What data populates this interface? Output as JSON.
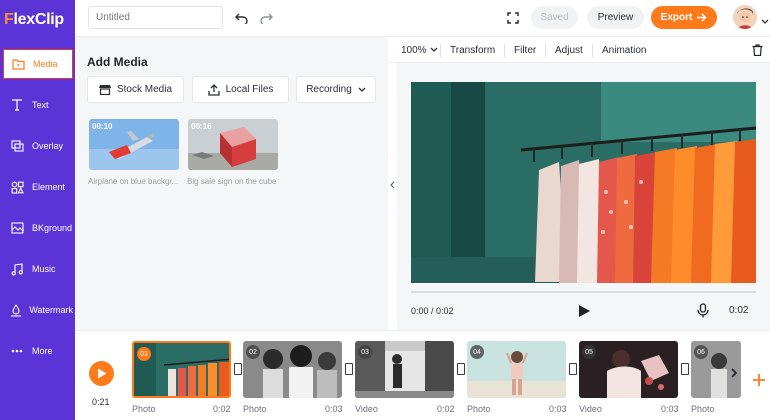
{
  "app": {
    "logo_text": "lexClip",
    "logo_mark": "F",
    "brand_color": "#5b34d8",
    "accent_color": "#ff7a1a"
  },
  "sidebar": {
    "items": [
      {
        "label": "Media",
        "icon": "folder-media-icon",
        "active": true
      },
      {
        "label": "Text",
        "icon": "text-icon"
      },
      {
        "label": "Overlay",
        "icon": "overlay-icon"
      },
      {
        "label": "Element",
        "icon": "element-icon"
      },
      {
        "label": "BKground",
        "icon": "background-icon"
      },
      {
        "label": "Music",
        "icon": "music-icon"
      },
      {
        "label": "Watermark",
        "icon": "watermark-icon"
      },
      {
        "label": "More",
        "icon": "more-dots-icon"
      }
    ]
  },
  "header": {
    "title_placeholder": "Untitled",
    "saved_label": "Saved",
    "preview_label": "Preview",
    "export_label": "Export"
  },
  "media_panel": {
    "title": "Add Media",
    "stock_label": "Stock Media",
    "local_label": "Local Files",
    "recording_label": "Recording",
    "assets": [
      {
        "duration": "00:10",
        "caption": "Airplane on blue backgr..."
      },
      {
        "duration": "00:16",
        "caption": "Big sale sign on the cube"
      }
    ]
  },
  "toolbar": {
    "zoom": "100%",
    "transform_label": "Transform",
    "filter_label": "Filter",
    "adjust_label": "Adjust",
    "animation_label": "Animation"
  },
  "player": {
    "time_display": "0:00 / 0:02",
    "duration_display": "0:02"
  },
  "timeline": {
    "current_time": "0:21",
    "clips": [
      {
        "num": "01",
        "type": "Photo",
        "duration": "0:02",
        "selected": true
      },
      {
        "num": "02",
        "type": "Photo",
        "duration": "0:03"
      },
      {
        "num": "03",
        "type": "Video",
        "duration": "0:02"
      },
      {
        "num": "04",
        "type": "Photo",
        "duration": "0:03"
      },
      {
        "num": "05",
        "type": "Video",
        "duration": "0:03"
      },
      {
        "num": "06",
        "type": "Photo",
        "duration": ""
      }
    ]
  }
}
